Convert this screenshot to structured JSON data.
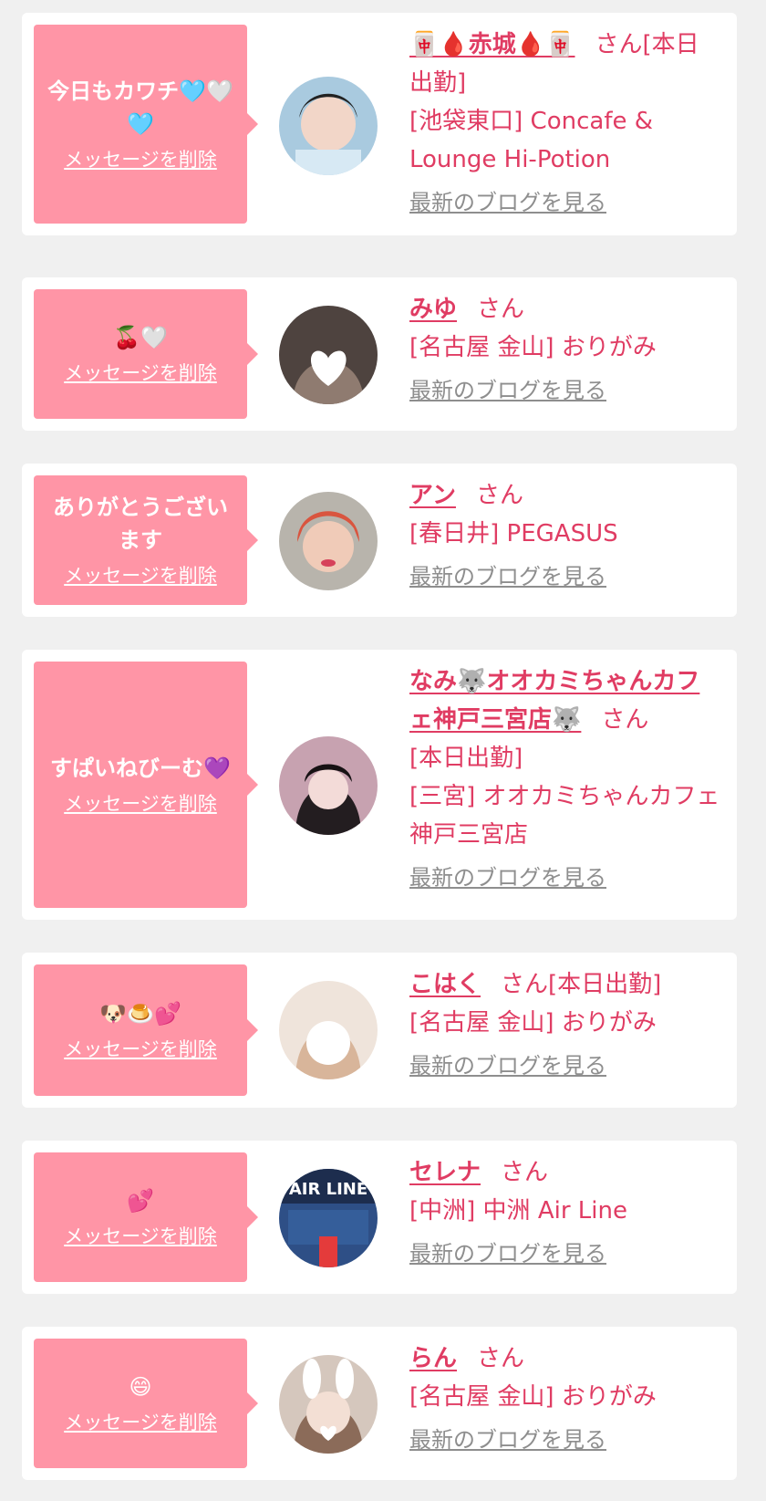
{
  "delete_label": "メッセージを削除",
  "blog_label": "最新のブログを見る",
  "san_label": "さん",
  "cards": [
    {
      "message": "今日もカワチ🩵🤍🩵",
      "name": "🀄🩸赤城🩸🀄",
      "suffix": "[本日出勤]",
      "store": "[池袋東口] Concafe & Lounge Hi-Potion",
      "avatar_colors": [
        "#b9d7e8",
        "#222222"
      ]
    },
    {
      "message": "🍒🤍",
      "name": "みゆ",
      "suffix": "",
      "store": "[名古屋 金山] おりがみ",
      "avatar_colors": [
        "#6b5f5a",
        "#3a2f2b"
      ]
    },
    {
      "message": "ありがとうございます",
      "name": "アン",
      "suffix": "",
      "store": "[春日井] PEGASUS",
      "avatar_colors": [
        "#e07a6a",
        "#c85454"
      ]
    },
    {
      "message": "すぱいねびーむ💜",
      "name": "なみ🐺オオカミちゃんカフェ神戸三宮店🐺",
      "suffix": "",
      "status": "[本日出勤]",
      "store": "[三宮] オオカミちゃんカフェ神戸三宮店",
      "avatar_colors": [
        "#d8a8b8",
        "#2a2326"
      ]
    },
    {
      "message": "🐶🍮💕",
      "name": "こはく",
      "suffix": "[本日出勤]",
      "store": "[名古屋 金山] おりがみ",
      "avatar_colors": [
        "#e8d6c8",
        "#c9a98a"
      ]
    },
    {
      "message": "💕",
      "name": "セレナ",
      "suffix": "",
      "store": "[中洲] 中洲 Air Line",
      "avatar_colors": [
        "#2e4f86",
        "#18243e"
      ],
      "avatar_text": "AIR LINE"
    },
    {
      "message": "😄",
      "name": "らん",
      "suffix": "",
      "store": "[名古屋 金山] おりがみ",
      "avatar_colors": [
        "#c8b7a8",
        "#8d705d"
      ]
    }
  ]
}
